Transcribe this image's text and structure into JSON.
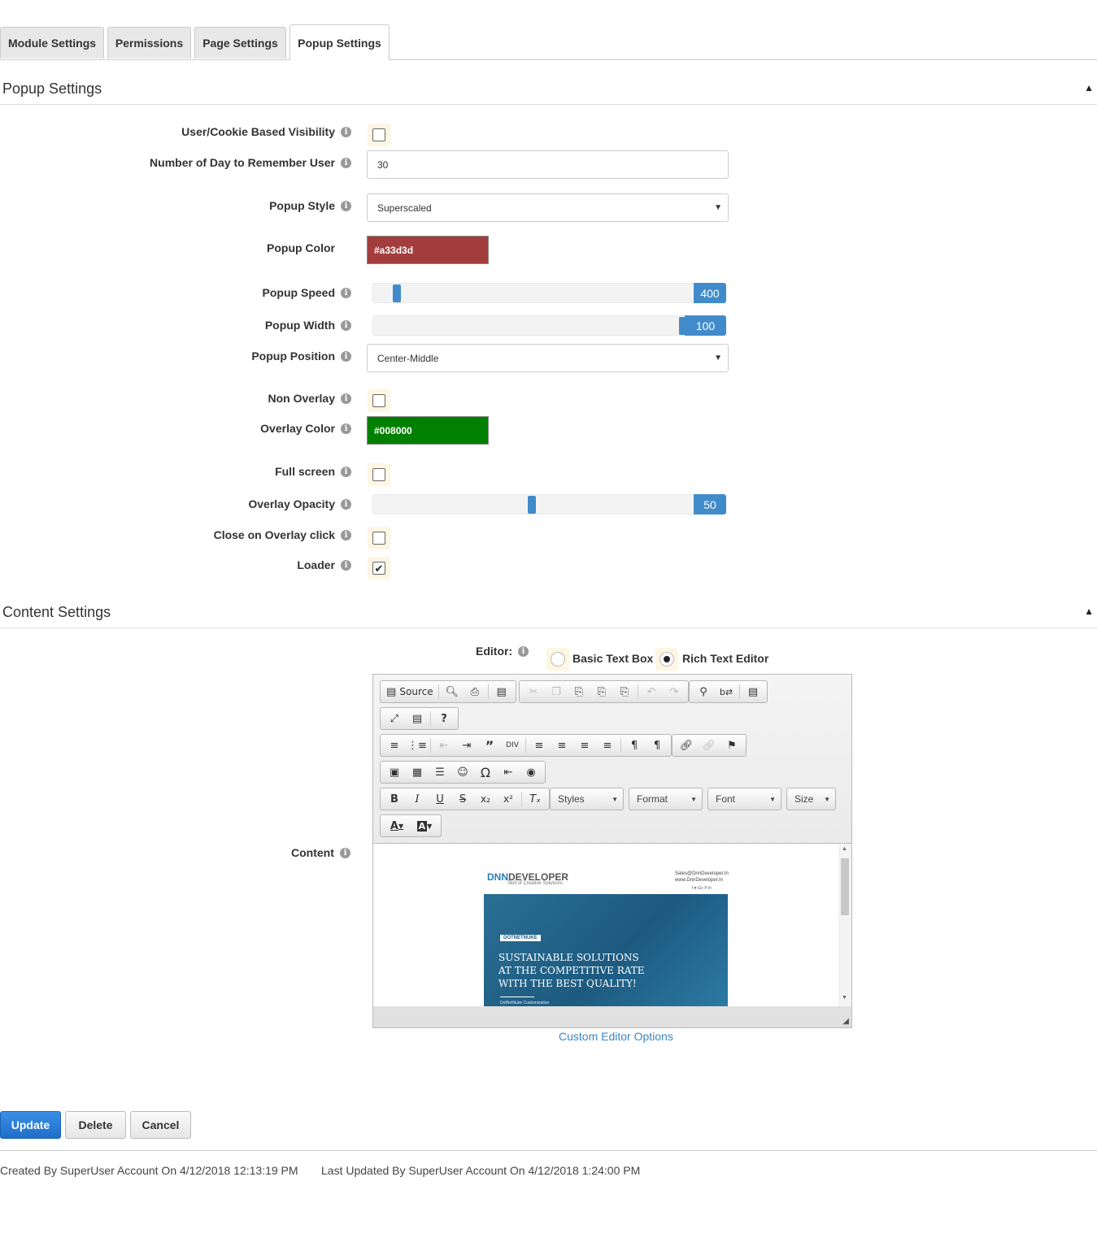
{
  "tabs": [
    {
      "label": "Module Settings"
    },
    {
      "label": "Permissions"
    },
    {
      "label": "Page Settings"
    },
    {
      "label": "Popup Settings",
      "active": true
    }
  ],
  "popup_section": {
    "title": "Popup Settings",
    "fields": {
      "visibility": {
        "label": "User/Cookie Based Visibility",
        "checked": false
      },
      "remember_days": {
        "label": "Number of Day to Remember User",
        "value": "30"
      },
      "popup_style": {
        "label": "Popup Style",
        "value": "Superscaled"
      },
      "popup_color": {
        "label": "Popup Color",
        "value": "#a33d3d",
        "color": "#a33d3d"
      },
      "popup_speed": {
        "label": "Popup Speed",
        "value": "400",
        "fraction": 0.07
      },
      "popup_width": {
        "label": "Popup Width",
        "value": "100",
        "fraction": 1.0
      },
      "popup_position": {
        "label": "Popup Position",
        "value": "Center-Middle"
      },
      "non_overlay": {
        "label": "Non Overlay",
        "checked": false
      },
      "overlay_color": {
        "label": "Overlay Color",
        "value": "#008000",
        "color": "#008000"
      },
      "full_screen": {
        "label": "Full screen",
        "checked": false
      },
      "overlay_opacity": {
        "label": "Overlay Opacity",
        "value": "50",
        "fraction": 0.5
      },
      "close_on_overlay": {
        "label": "Close on Overlay click",
        "checked": false
      },
      "loader": {
        "label": "Loader",
        "checked": true
      }
    }
  },
  "content_section": {
    "title": "Content Settings",
    "editor_label": "Editor:",
    "editor_options": {
      "basic": "Basic Text Box",
      "rich": "Rich Text Editor",
      "selected": "rich"
    },
    "content_label": "Content",
    "toolbar": {
      "source_label": "Source",
      "styles_label": "Styles",
      "format_label": "Format",
      "font_label": "Font",
      "size_label": "Size"
    },
    "preview": {
      "brand": "DNNDEVELOPER",
      "brand_dnn": "DNN",
      "brand_rest": "DEVELOPER",
      "tagline": "Skill of Creative Solutions",
      "contact_email": "Sales@DnnDeveloper.In",
      "contact_web": "www.DnnDeveloper.In",
      "social": "f ♥ G+ P in",
      "badge": "DOTNETNUKE",
      "headline_1": "SUSTAINABLE SOLUTIONS",
      "headline_2": "AT THE COMPETITIVE RATE",
      "headline_3": "WITH THE BEST QUALITY!",
      "footnote": "DotNetNuke Customization"
    },
    "custom_options_link": "Custom Editor Options"
  },
  "actions": {
    "update": "Update",
    "delete": "Delete",
    "cancel": "Cancel"
  },
  "footer": {
    "created": "Created By SuperUser Account On 4/12/2018 12:13:19 PM",
    "updated": "Last Updated By SuperUser Account On 4/12/2018 1:24:00 PM"
  },
  "colors": {
    "accent": "#428bca",
    "primary_button": "#2a7fd9",
    "link": "#3a87c8"
  }
}
